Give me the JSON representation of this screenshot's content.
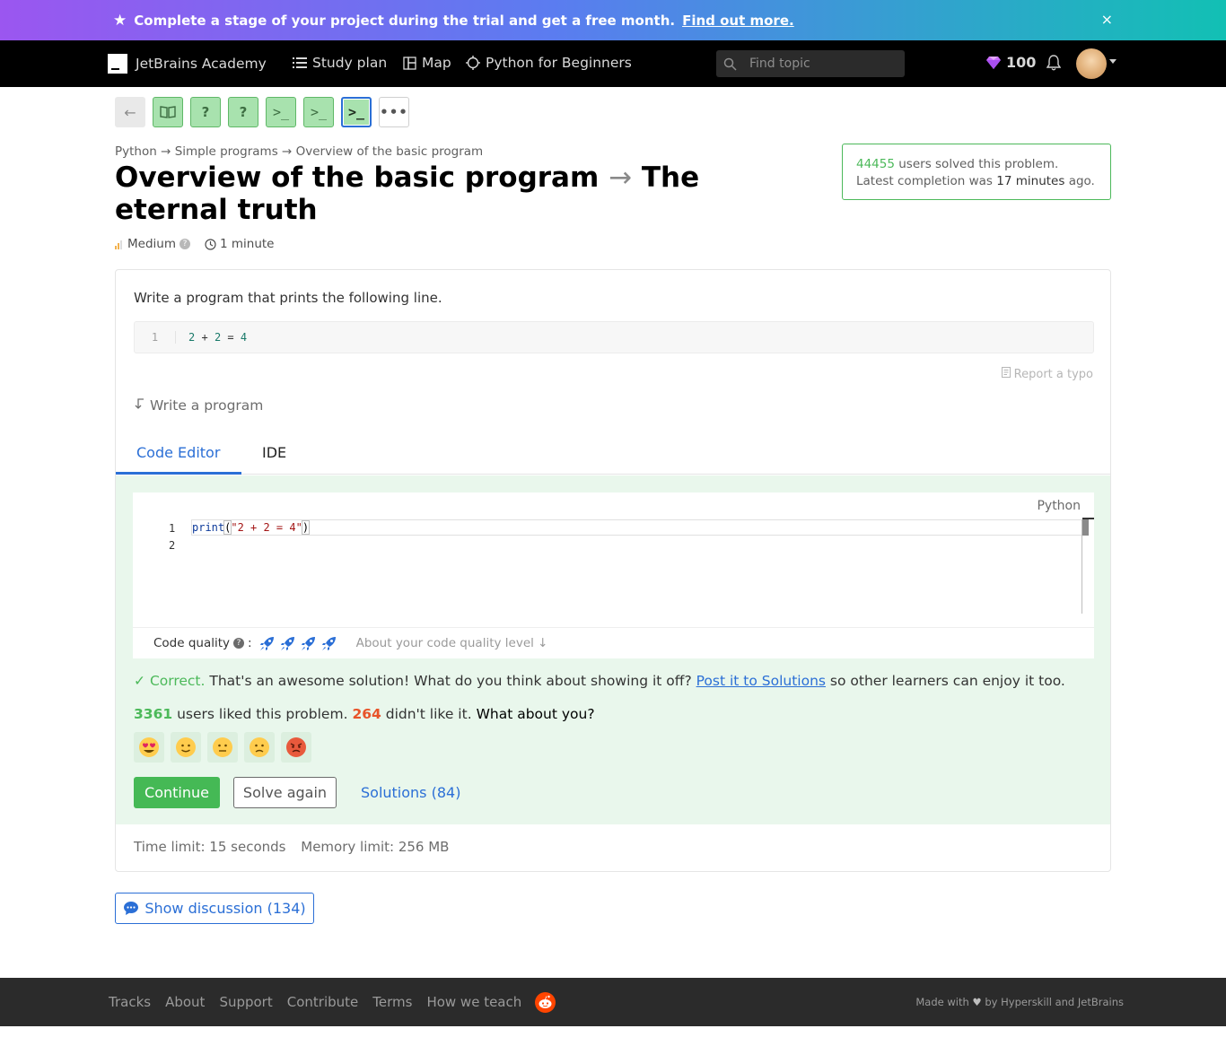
{
  "banner": {
    "text": "Complete a stage of your project during the trial and get a free month.",
    "link": "Find out more.",
    "close": "×"
  },
  "nav": {
    "brand": "JetBrains Academy",
    "study_plan": "Study plan",
    "map": "Map",
    "track": "Python for Beginners",
    "search_placeholder": "Find topic",
    "gems": "100"
  },
  "steps": {
    "back": "←",
    "items": [
      {
        "type": "theory",
        "state": "done"
      },
      {
        "type": "quiz",
        "label": "?",
        "state": "done"
      },
      {
        "type": "quiz",
        "label": "?",
        "state": "done"
      },
      {
        "type": "code",
        "label": ">_",
        "state": "done"
      },
      {
        "type": "code",
        "label": ">_",
        "state": "done"
      },
      {
        "type": "code",
        "label": ">_",
        "state": "current"
      }
    ],
    "more": "•••"
  },
  "breadcrumb": "Python → Simple programs → Overview of the basic program",
  "title": {
    "topic": "Overview of the basic program",
    "arrow": "→",
    "problem": "The eternal truth"
  },
  "meta": {
    "difficulty": "Medium",
    "time": "1 minute"
  },
  "stats": {
    "solved_count": "44455",
    "solved_text": "users solved this problem.",
    "latest_prefix": "Latest completion was",
    "latest_value": "17 minutes",
    "latest_suffix": "ago."
  },
  "statement": "Write a program that prints the following line.",
  "sample": {
    "line_number": "1",
    "tokens": [
      "2",
      "+",
      "2",
      "=",
      "4"
    ]
  },
  "report_typo": "Report a typo",
  "write_program": "Write a program",
  "tabs": [
    "Code Editor",
    "IDE"
  ],
  "editor": {
    "language": "Python",
    "line_numbers": [
      "1",
      "2"
    ],
    "code_fn": "print",
    "code_open": "(",
    "code_string": "\"2 + 2 = 4\"",
    "code_close": ")"
  },
  "quality": {
    "label": "Code quality",
    "colon": ":",
    "rockets": 4,
    "about": "About your code quality level ↓"
  },
  "result": {
    "status": "Correct.",
    "message": "That's an awesome solution! What do you think about showing it off?",
    "link": "Post it to Solutions",
    "tail": "so other learners can enjoy it too."
  },
  "likes": {
    "liked": "3361",
    "liked_text": "users liked this problem.",
    "disliked": "264",
    "disliked_text": "didn't like it.",
    "question": "What about you?"
  },
  "reactions": [
    "heart-eyes",
    "smile",
    "neutral",
    "frown",
    "angry"
  ],
  "actions": {
    "continue": "Continue",
    "solve_again": "Solve again",
    "solutions": "Solutions (84)"
  },
  "limits": {
    "time": "Time limit: 15 seconds",
    "memory": "Memory limit: 256 MB"
  },
  "discussion": "Show discussion (134)",
  "footer": {
    "links": [
      "Tracks",
      "About",
      "Support",
      "Contribute",
      "Terms",
      "How we teach"
    ],
    "made_prefix": "Made with",
    "made_suffix": "by Hyperskill and JetBrains"
  },
  "colors": {
    "accent_blue": "#2b6fd6",
    "success_green": "#45b955",
    "success_bg": "#e9f7ec",
    "dislike_red": "#e8542a",
    "gem_purple": "#c86bff"
  }
}
